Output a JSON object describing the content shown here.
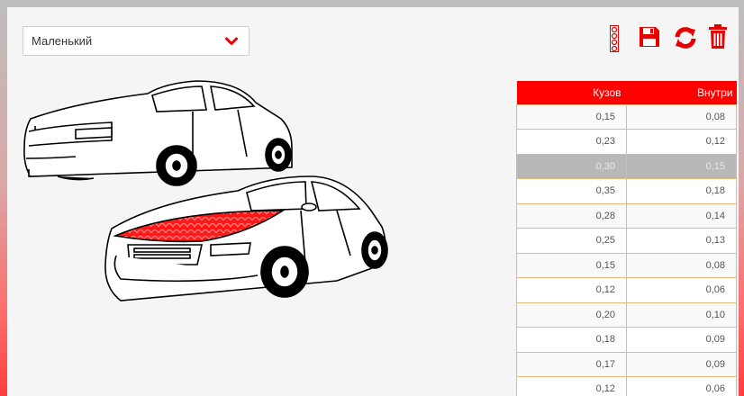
{
  "size_select": {
    "value": "Маленький"
  },
  "toolbar": {
    "icons": [
      "pattern-icon",
      "save-icon",
      "refresh-icon",
      "trash-icon"
    ],
    "accent": "#ff0000"
  },
  "table": {
    "headers": [
      "Кузов",
      "Внутри"
    ],
    "rows": [
      [
        "0,15",
        "0,08"
      ],
      [
        "0,23",
        "0,12"
      ],
      [
        "0,30",
        "0,15"
      ],
      [
        "0,35",
        "0,18"
      ],
      [
        "0,28",
        "0,14"
      ],
      [
        "0,25",
        "0,13"
      ],
      [
        "0,15",
        "0,08"
      ],
      [
        "0,12",
        "0,06"
      ],
      [
        "0,20",
        "0,10"
      ],
      [
        "0,18",
        "0,09"
      ],
      [
        "0,17",
        "0,09"
      ],
      [
        "0,12",
        "0,06"
      ]
    ],
    "selected_row": 2
  }
}
